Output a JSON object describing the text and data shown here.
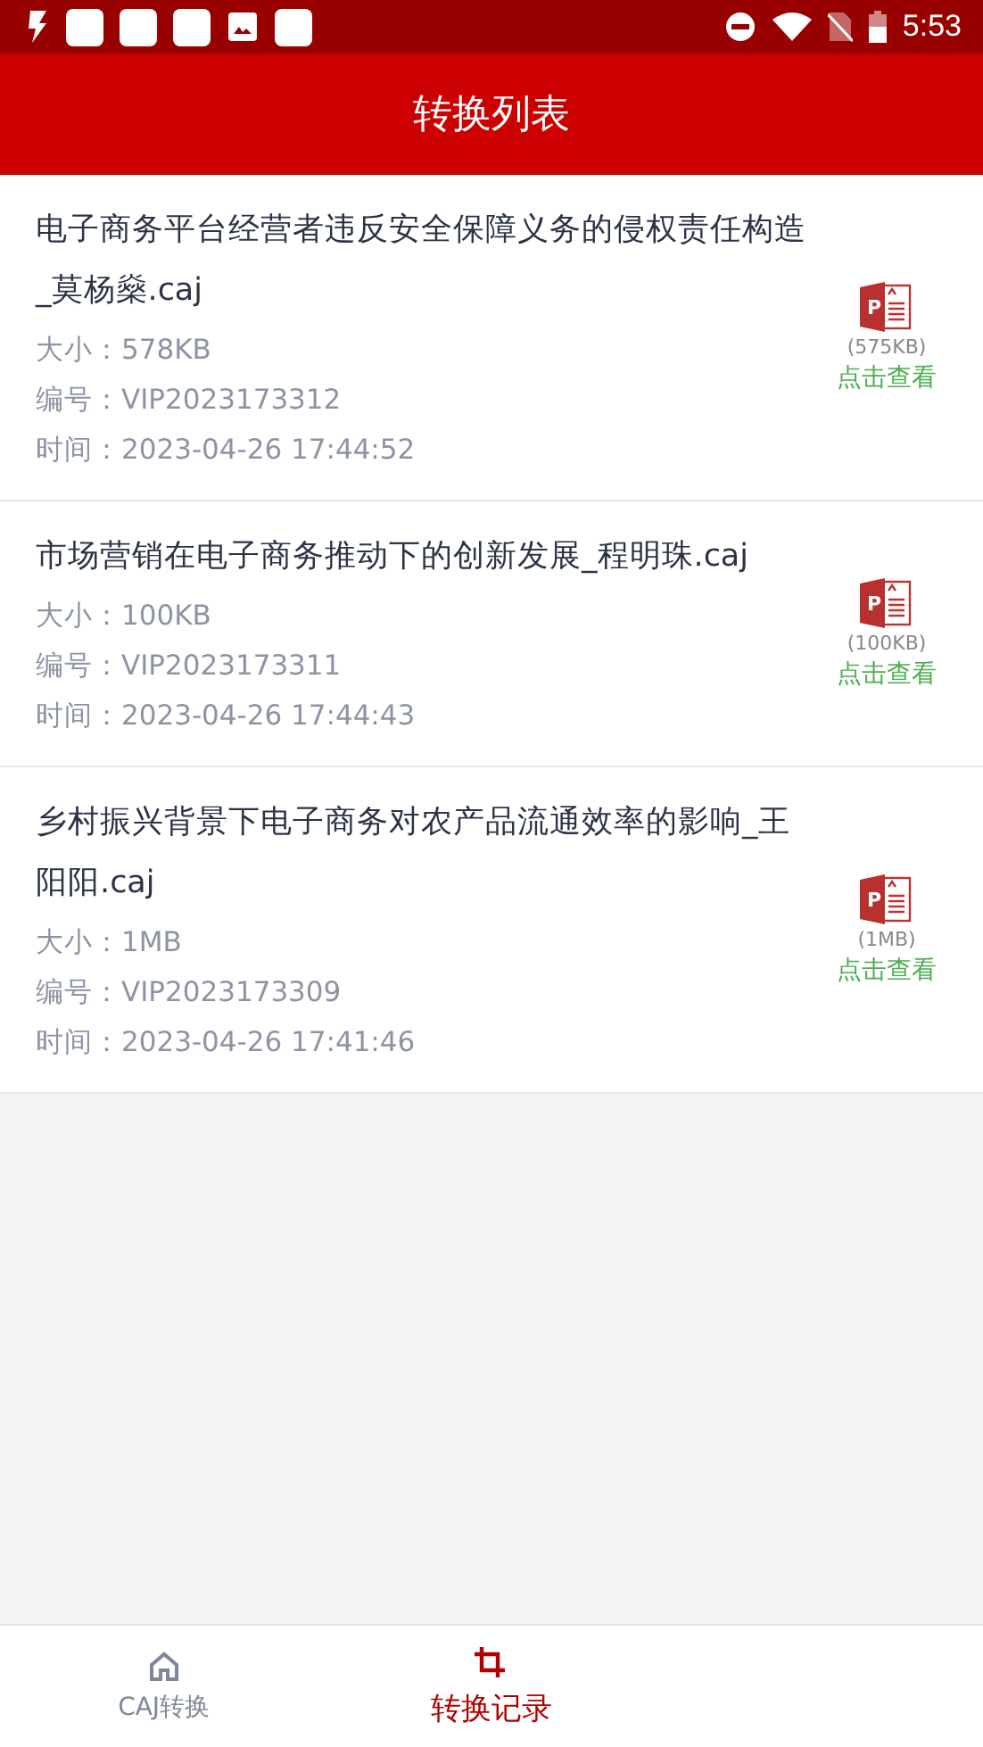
{
  "status_bar": {
    "time": "5:53"
  },
  "header": {
    "title": "转换列表"
  },
  "files": [
    {
      "name": "电子商务平台经营者违反安全保障义务的侵权责任构造_莫杨燊.caj",
      "size": "大小：578KB",
      "number": "编号：VIP2023173312",
      "time": "时间：2023-04-26 17:44:52",
      "icon_letter": "P",
      "result_size": "(575KB)",
      "action": "点击查看"
    },
    {
      "name": "市场营销在电子商务推动下的创新发展_程明珠.caj",
      "size": "大小：100KB",
      "number": "编号：VIP2023173311",
      "time": "时间：2023-04-26 17:44:43",
      "icon_letter": "P",
      "result_size": "(100KB)",
      "action": "点击查看"
    },
    {
      "name": "乡村振兴背景下电子商务对农产品流通效率的影响_王阳阳.caj",
      "size": "大小：1MB",
      "number": "编号：VIP2023173309",
      "time": "时间：2023-04-26 17:41:46",
      "icon_letter": "P",
      "result_size": "(1MB)",
      "action": "点击查看"
    }
  ],
  "bottom_nav": [
    {
      "label": "CAJ转换",
      "kind": "home",
      "selected": false
    },
    {
      "label": "转换记录",
      "kind": "crop",
      "selected": true
    }
  ]
}
